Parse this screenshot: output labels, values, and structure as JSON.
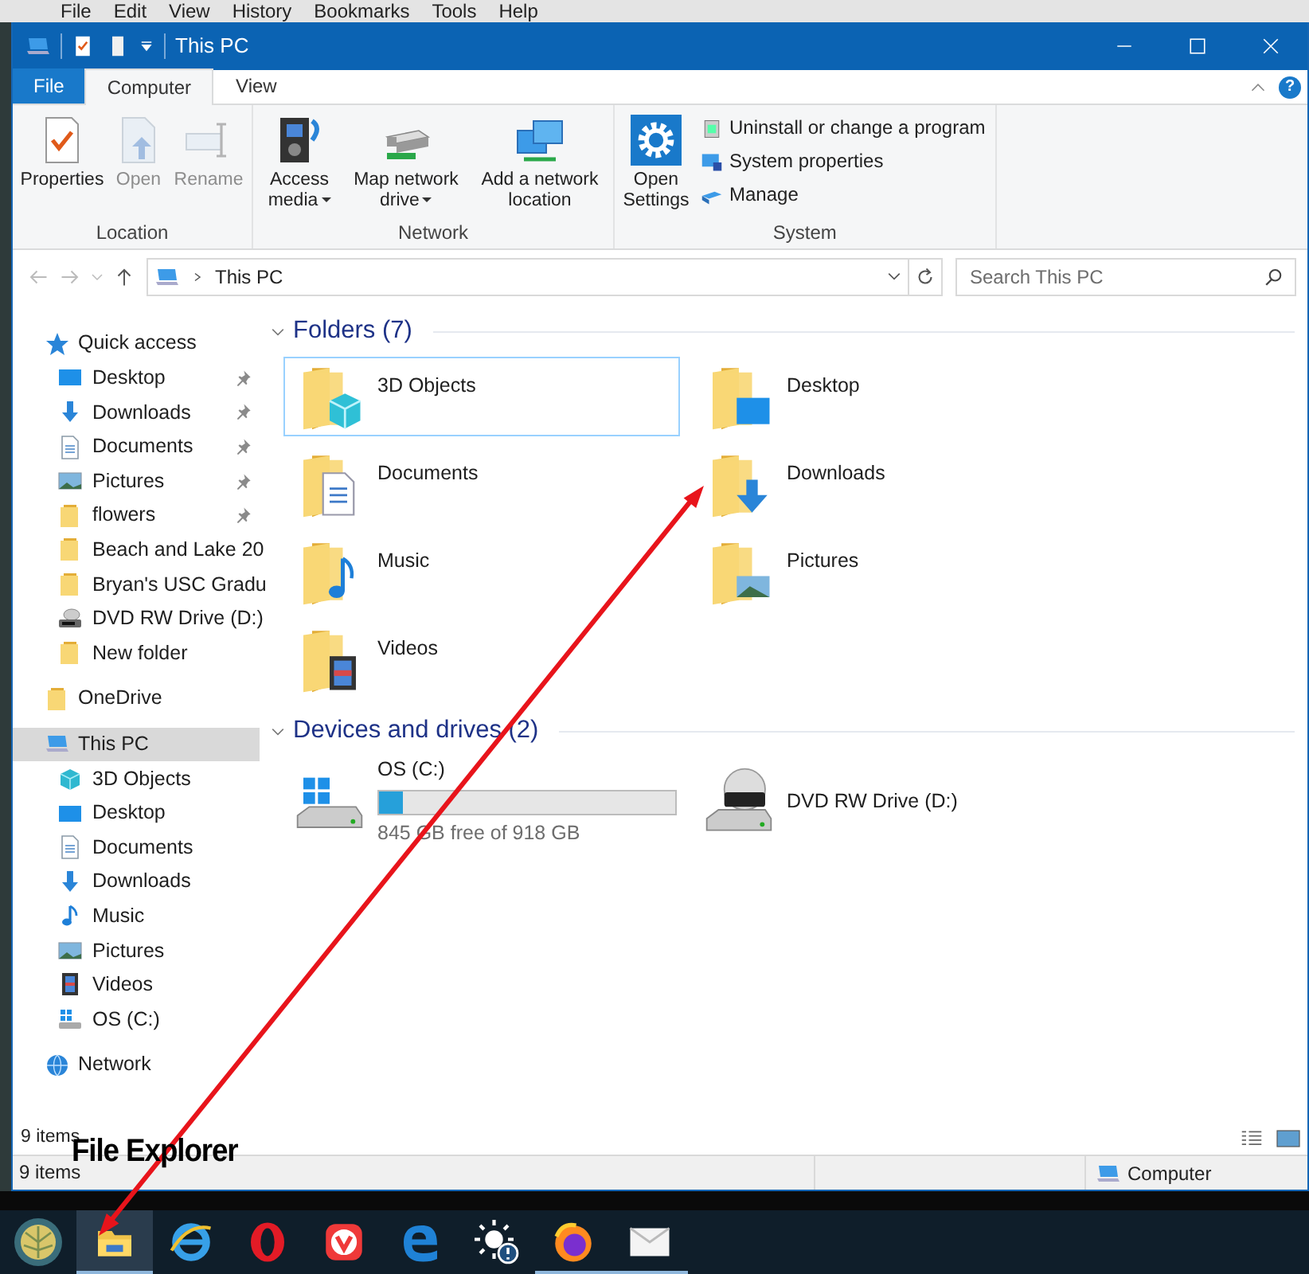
{
  "background_menu": [
    "File",
    "Edit",
    "View",
    "History",
    "Bookmarks",
    "Tools",
    "Help"
  ],
  "window": {
    "title": "This PC"
  },
  "ribbon": {
    "tabs": [
      {
        "label": "File",
        "kind": "file",
        "selected": false
      },
      {
        "label": "Computer",
        "kind": "tab",
        "selected": true
      },
      {
        "label": "View",
        "kind": "tab",
        "selected": false
      }
    ],
    "help": "?",
    "groups": [
      {
        "name": "Location",
        "commands": [
          {
            "label": "Properties",
            "disabled": false,
            "dropdown": false
          },
          {
            "label": "Open",
            "disabled": true,
            "dropdown": false
          },
          {
            "label": "Rename",
            "disabled": true,
            "dropdown": false
          }
        ]
      },
      {
        "name": "Network",
        "commands": [
          {
            "label": "Access media",
            "disabled": false,
            "dropdown": true
          },
          {
            "label": "Map network drive",
            "disabled": false,
            "dropdown": true
          },
          {
            "label": "Add a network location",
            "disabled": false,
            "dropdown": false
          }
        ]
      },
      {
        "name": "System",
        "commands": [
          {
            "label": "Open Settings",
            "disabled": false,
            "dropdown": false
          }
        ],
        "small_commands": [
          {
            "label": "Uninstall or change a program"
          },
          {
            "label": "System properties"
          },
          {
            "label": "Manage"
          }
        ]
      }
    ]
  },
  "address_bar": {
    "path": "This PC"
  },
  "search": {
    "placeholder": "Search This PC"
  },
  "navigation": [
    {
      "label": "Quick access",
      "selected": false,
      "children": [
        {
          "label": "Desktop",
          "pinned": true,
          "selected": false
        },
        {
          "label": "Downloads",
          "pinned": true,
          "selected": false
        },
        {
          "label": "Documents",
          "pinned": true,
          "selected": false
        },
        {
          "label": "Pictures",
          "pinned": true,
          "selected": false
        },
        {
          "label": "flowers",
          "pinned": true,
          "selected": false
        },
        {
          "label": "Beach and Lake 20",
          "pinned": false,
          "selected": false
        },
        {
          "label": "Bryan's USC Gradu",
          "pinned": false,
          "selected": false
        },
        {
          "label": "DVD RW Drive (D:)",
          "pinned": false,
          "selected": false
        },
        {
          "label": "New folder",
          "pinned": false,
          "selected": false
        }
      ]
    },
    {
      "label": "OneDrive",
      "selected": false
    },
    {
      "label": "This PC",
      "selected": true,
      "children": [
        {
          "label": "3D Objects",
          "pinned": false,
          "selected": false
        },
        {
          "label": "Desktop",
          "pinned": false,
          "selected": false
        },
        {
          "label": "Documents",
          "pinned": false,
          "selected": false
        },
        {
          "label": "Downloads",
          "pinned": false,
          "selected": false
        },
        {
          "label": "Music",
          "pinned": false,
          "selected": false
        },
        {
          "label": "Pictures",
          "pinned": false,
          "selected": false
        },
        {
          "label": "Videos",
          "pinned": false,
          "selected": false
        },
        {
          "label": "OS (C:)",
          "pinned": false,
          "selected": false
        }
      ]
    },
    {
      "label": "Network",
      "selected": false
    }
  ],
  "sections": [
    {
      "title": "Folders (7)",
      "expanded": true,
      "kind": "folders",
      "items": [
        {
          "label": "3D Objects",
          "selected": true
        },
        {
          "label": "Desktop",
          "selected": false
        },
        {
          "label": "Documents",
          "selected": false
        },
        {
          "label": "Downloads",
          "selected": false
        },
        {
          "label": "Music",
          "selected": false
        },
        {
          "label": "Pictures",
          "selected": false
        },
        {
          "label": "Videos",
          "selected": false
        }
      ]
    },
    {
      "title": "Devices and drives (2)",
      "expanded": true,
      "kind": "drives",
      "items": [
        {
          "label": "OS (C:)",
          "selected": false,
          "level": 0.08,
          "detail": "845 GB free of 918 GB"
        },
        {
          "label": "DVD RW Drive (D:)",
          "selected": false
        }
      ]
    }
  ],
  "pane_footer": {
    "item_count": "9 items"
  },
  "status_bar": {
    "item_count": "9 items",
    "location": "Computer"
  },
  "annotation": {
    "label": "File Explorer"
  },
  "taskbar": {
    "items": [
      {
        "selected": true,
        "running": true
      },
      {
        "selected": false,
        "running": false
      },
      {
        "selected": false,
        "running": false
      },
      {
        "selected": false,
        "running": false
      },
      {
        "selected": false,
        "running": false
      },
      {
        "selected": false,
        "running": false
      },
      {
        "selected": false,
        "running": true
      },
      {
        "selected": false,
        "running": true
      }
    ]
  }
}
